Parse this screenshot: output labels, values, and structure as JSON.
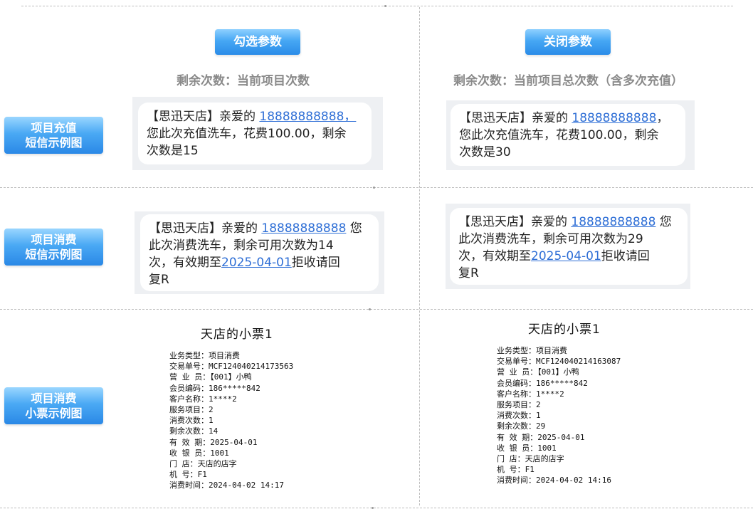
{
  "header": {
    "left_pill": "勾选参数",
    "right_pill": "关闭参数",
    "left_subtitle": "剩余次数：当前项目次数",
    "right_subtitle": "剩余次数：当前项目总次数（含多次充值）"
  },
  "side_labels": {
    "recharge": [
      "项目充值",
      "短信示例图"
    ],
    "consume": [
      "项目消费",
      "短信示例图"
    ],
    "receipt": [
      "项目消费",
      "小票示例图"
    ]
  },
  "sms": {
    "recharge_left": {
      "prefix": "【思迅天店】亲爱的 ",
      "phone": "18888888888，",
      "line2": "您此次充值洗车，花费100.00，剩余",
      "line3": "次数是15"
    },
    "recharge_right": {
      "prefix": "【思迅天店】亲爱的 ",
      "phone": "18888888888",
      "suffix": "，",
      "line2": "您此次充值洗车，花费100.00，剩余",
      "line3": "次数是30"
    },
    "consume_left": {
      "prefix": "【思迅天店】亲爱的 ",
      "phone": "18888888888",
      "suffix": " 您",
      "line2": "此次消费洗车，剩余可用次数为14",
      "line3a": "次，有效期至",
      "date": "2025-04-01",
      "line3b": "拒收请回",
      "line4": "复R"
    },
    "consume_right": {
      "prefix": "【思迅天店】亲爱的 ",
      "phone": "18888888888",
      "suffix": " 您",
      "line2": "此次消费洗车，剩余可用次数为29",
      "line3a": "次，有效期至",
      "date": "2025-04-01",
      "line3b": "拒收请回",
      "line4": "复R"
    }
  },
  "receipt_left": {
    "title": "天店的小票1",
    "rows": [
      "业务类型：项目消费",
      "交易单号：MCF124040214173563",
      "营 业 员：【001】小鸭",
      "会员编码：186*****842",
      "客户名称：1****2",
      "服务项目：2",
      "消费次数：1",
      "剩余次数：14",
      "有 效 期：2025-04-01",
      "收 银 员：1001",
      "门    店：天店的店字",
      "机    号：F1",
      "消费时间：2024-04-02 14:17"
    ]
  },
  "receipt_right": {
    "title": "天店的小票1",
    "rows": [
      "业务类型：项目消费",
      "交易单号：MCF124040214163087",
      "营 业 员：【001】小鸭",
      "会员编码：186*****842",
      "客户名称：1****2",
      "服务项目：2",
      "消费次数：1",
      "剩余次数：29",
      "有 效 期：2025-04-01",
      "收 银 员：1001",
      "门    店：天店的店字",
      "机    号：F1",
      "消费时间：2024-04-02 14:16"
    ]
  }
}
